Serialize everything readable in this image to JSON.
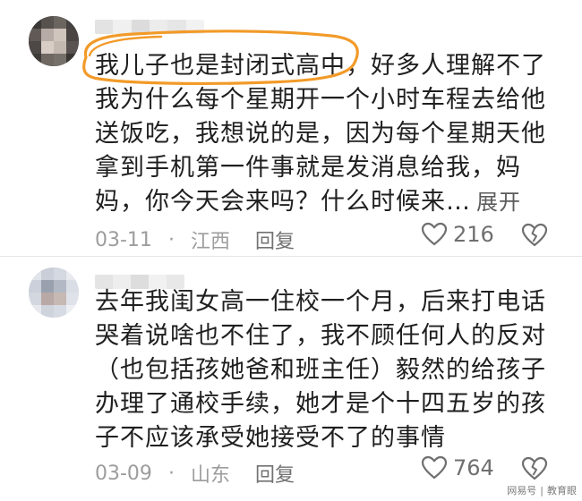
{
  "comments": [
    {
      "text": "我儿子也是封闭式高中，好多人理解不了我为什么每个星期开一个小时车程去给他送饭吃，我想说的是，因为每个星期天他拿到手机第一件事就是发消息给我，妈妈，你今天会来吗？什么时候来…",
      "expand_label": "展开",
      "date": "03-11",
      "location": "江西",
      "reply_label": "回复",
      "like_count": "216"
    },
    {
      "text": "去年我闺女高一住校一个月，后来打电话哭着说啥也不住了，我不顾任何人的反对（也包括孩她爸和班主任）毅然的给孩子办理了通校手续，她才是个十四五岁的孩子不应该承受她接受不了的事情",
      "date": "03-09",
      "location": "山东",
      "reply_label": "回复",
      "like_count": "764"
    }
  ],
  "watermark": {
    "brand": "网易号",
    "source": "教育眼"
  },
  "colors": {
    "highlight": "#f29a28",
    "text": "#1f1f1f",
    "meta": "#9d9d9d"
  },
  "icons": {
    "like": "heart-outline-icon",
    "dislike": "broken-heart-icon"
  }
}
